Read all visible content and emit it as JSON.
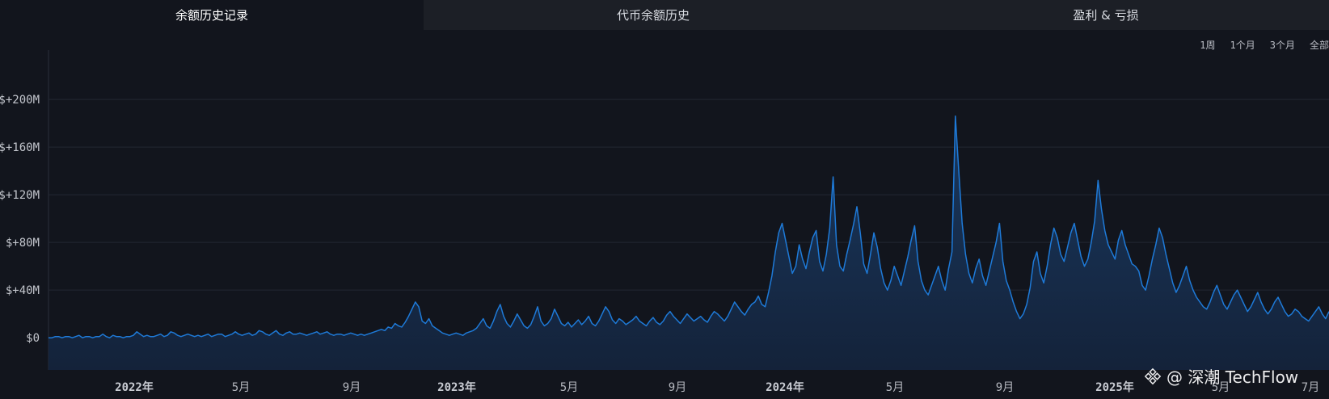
{
  "tabs": [
    {
      "label": "余额历史记录",
      "active": true
    },
    {
      "label": "代币余额历史",
      "active": false
    },
    {
      "label": "盈利 & 亏损",
      "active": false
    }
  ],
  "ranges": [
    "1周",
    "1个月",
    "3个月",
    "全部"
  ],
  "watermark": "@ 深潮 TechFlow",
  "colors": {
    "line": "#1e7ad8",
    "area_top": "#1a3c66",
    "area_bottom": "#14233b",
    "background": "#12151d"
  },
  "chart_data": {
    "type": "area",
    "title": "",
    "xlabel": "",
    "ylabel": "",
    "y_ticks": [
      "$0",
      "$+40M",
      "$+80M",
      "$+120M",
      "$+160M",
      "$+200M"
    ],
    "ylim": [
      -27,
      236
    ],
    "x_ticks": [
      {
        "label": "2022年",
        "year": true
      },
      {
        "label": "5月",
        "year": false
      },
      {
        "label": "9月",
        "year": false
      },
      {
        "label": "2023年",
        "year": true
      },
      {
        "label": "5月",
        "year": false
      },
      {
        "label": "9月",
        "year": false
      },
      {
        "label": "2024年",
        "year": true
      },
      {
        "label": "5月",
        "year": false
      },
      {
        "label": "9月",
        "year": false
      },
      {
        "label": "2025年",
        "year": true
      },
      {
        "label": "5月",
        "year": false
      },
      {
        "label": "7月",
        "year": false
      }
    ],
    "grid": true,
    "series": [
      {
        "values": [
          0,
          0,
          1,
          1,
          0,
          1,
          1,
          0,
          1,
          2,
          0,
          1,
          1,
          0,
          1,
          1,
          3,
          1,
          0,
          2,
          1,
          1,
          0,
          1,
          1,
          2,
          5,
          3,
          1,
          2,
          1,
          1,
          2,
          3,
          1,
          2,
          5,
          4,
          2,
          1,
          2,
          3,
          2,
          1,
          2,
          1,
          2,
          3,
          1,
          2,
          3,
          3,
          1,
          2,
          3,
          5,
          3,
          2,
          3,
          4,
          2,
          3,
          6,
          5,
          3,
          2,
          4,
          6,
          3,
          2,
          4,
          5,
          3,
          3,
          4,
          3,
          2,
          3,
          4,
          5,
          3,
          4,
          5,
          3,
          2,
          3,
          3,
          2,
          3,
          4,
          3,
          2,
          3,
          2,
          3,
          4,
          5,
          6,
          7,
          6,
          9,
          8,
          12,
          10,
          9,
          13,
          18,
          24,
          30,
          26,
          14,
          12,
          16,
          10,
          8,
          6,
          4,
          3,
          2,
          3,
          4,
          3,
          2,
          4,
          5,
          6,
          8,
          12,
          16,
          10,
          8,
          14,
          22,
          28,
          18,
          12,
          9,
          14,
          20,
          15,
          10,
          8,
          11,
          18,
          26,
          14,
          10,
          12,
          16,
          24,
          18,
          12,
          10,
          13,
          9,
          12,
          15,
          11,
          14,
          18,
          12,
          10,
          14,
          20,
          26,
          22,
          15,
          12,
          16,
          14,
          11,
          13,
          15,
          18,
          14,
          12,
          10,
          14,
          17,
          13,
          11,
          14,
          19,
          22,
          18,
          15,
          12,
          16,
          20,
          17,
          14,
          16,
          18,
          15,
          13,
          18,
          22,
          20,
          17,
          14,
          18,
          24,
          30,
          26,
          22,
          19,
          24,
          28,
          30,
          35,
          28,
          26,
          38,
          52,
          72,
          88,
          96,
          82,
          68,
          54,
          60,
          78,
          66,
          58,
          72,
          84,
          90,
          64,
          56,
          70,
          92,
          135,
          78,
          60,
          56,
          70,
          82,
          95,
          110,
          88,
          62,
          54,
          70,
          88,
          76,
          58,
          46,
          40,
          48,
          60,
          52,
          44,
          56,
          68,
          82,
          94,
          64,
          48,
          40,
          36,
          44,
          52,
          60,
          48,
          40,
          58,
          72,
          186,
          140,
          96,
          70,
          54,
          46,
          58,
          66,
          52,
          44,
          56,
          68,
          80,
          96,
          64,
          48,
          40,
          30,
          22,
          16,
          20,
          28,
          42,
          64,
          72,
          54,
          46,
          60,
          78,
          92,
          84,
          70,
          64,
          76,
          88,
          96,
          82,
          68,
          60,
          66,
          80,
          98,
          132,
          108,
          90,
          78,
          72,
          66,
          82,
          90,
          78,
          70,
          62,
          60,
          56,
          44,
          40,
          52,
          66,
          78,
          92,
          84,
          70,
          58,
          46,
          38,
          44,
          52,
          60,
          48,
          40,
          34,
          30,
          26,
          24,
          30,
          38,
          44,
          36,
          28,
          24,
          30,
          36,
          40,
          34,
          28,
          22,
          26,
          32,
          38,
          30,
          24,
          20,
          24,
          30,
          34,
          28,
          22,
          18,
          20,
          24,
          22,
          18,
          16,
          14,
          18,
          22,
          26,
          20,
          16,
          22
        ]
      }
    ]
  }
}
